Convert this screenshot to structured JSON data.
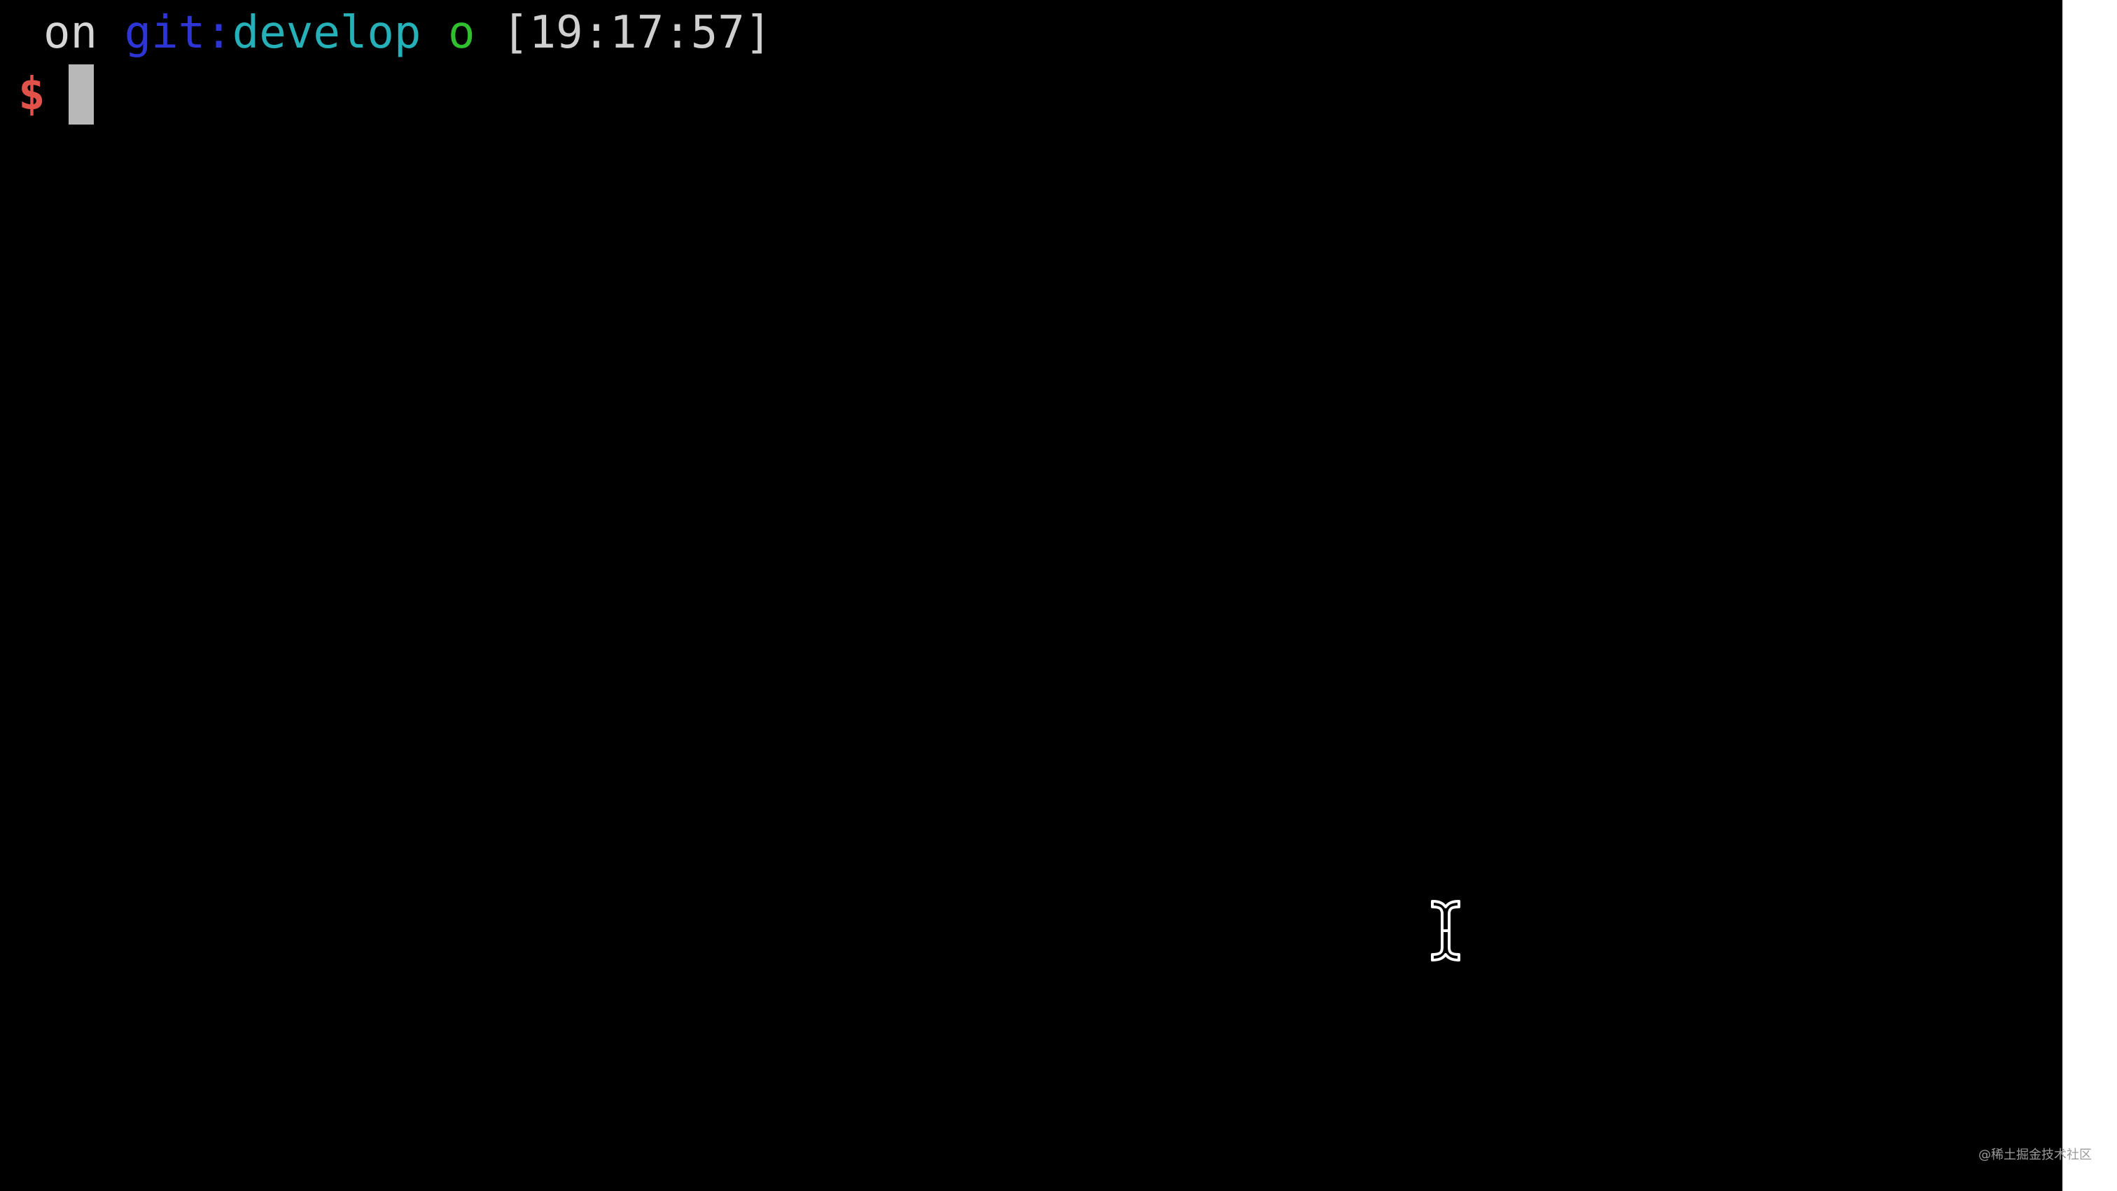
{
  "terminal": {
    "status_line": {
      "on": "on",
      "git_prefix": "git:",
      "branch": "develop",
      "dirty_marker": "o",
      "timestamp": "[19:17:57]"
    },
    "prompt_symbol": "$",
    "input_value": ""
  },
  "watermark": "@稀土掘金技术社区",
  "icons": {
    "pointer": "text-cursor-icon"
  },
  "colors": {
    "background": "#000000",
    "text": "#d6d6d6",
    "git_prefix": "#2d35d6",
    "branch": "#26b0b8",
    "dirty_marker": "#2fbf2f",
    "prompt_symbol": "#e0524a",
    "cursor_block": "#b8b8b8"
  }
}
